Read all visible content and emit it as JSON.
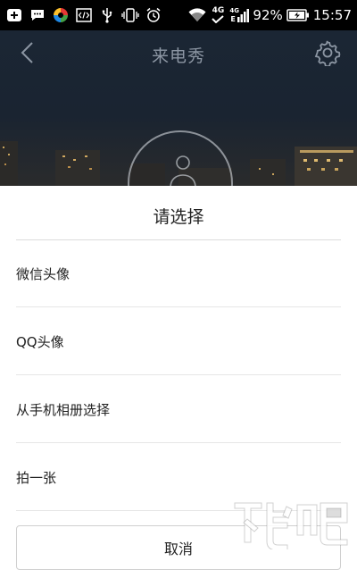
{
  "status_bar": {
    "battery_percent": "92%",
    "time": "15:57",
    "net_label_1": "4G",
    "net_label_2": "4G",
    "net_label_3": "E",
    "icons": [
      "plus-badge-icon",
      "chat-bubble-icon",
      "color-wheel-icon",
      "code-icon",
      "usb-icon",
      "vibrate-icon",
      "alarm-icon",
      "wifi-icon",
      "volte-check-icon",
      "signal-icon",
      "battery-icon"
    ]
  },
  "header": {
    "title": "来电秀",
    "back_icon": "chevron-left-icon",
    "settings_icon": "gear-icon"
  },
  "sheet": {
    "title": "请选择",
    "options": [
      {
        "label": "微信头像"
      },
      {
        "label": "QQ头像"
      },
      {
        "label": "从手机相册选择"
      },
      {
        "label": "拍一张"
      }
    ],
    "cancel_label": "取消"
  },
  "colors": {
    "status_bar_bg": "#000000",
    "header_bg": "#1b2634",
    "sheet_bg": "#ffffff",
    "divider": "#dcdcdc"
  }
}
